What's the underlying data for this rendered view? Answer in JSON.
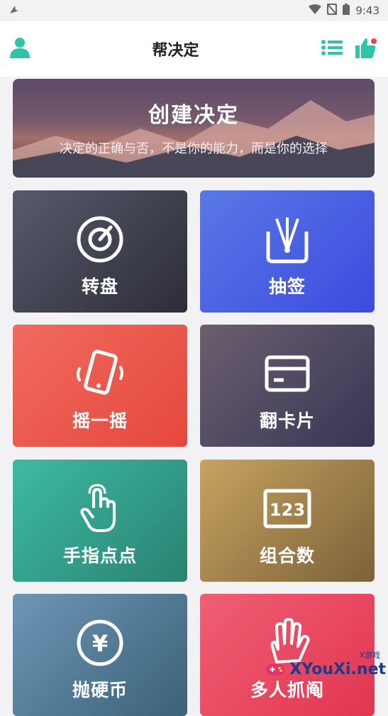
{
  "status_bar": {
    "time": "9:43",
    "icons": [
      "notification-bird-icon",
      "wifi-icon",
      "no-sim-icon",
      "battery-icon"
    ]
  },
  "appbar": {
    "title": "帮决定",
    "left_icon": "user-icon",
    "right_icons": [
      "list-icon",
      "thumbs-up-icon"
    ],
    "accent": "#2ec4a6",
    "badge_color": "#e5484d"
  },
  "banner": {
    "title": "创建决定",
    "subtitle": "决定的正确与否，不是你的能力，而是你的选择"
  },
  "cards": [
    {
      "label": "转盘",
      "icon": "spinner-dial-icon"
    },
    {
      "label": "抽签",
      "icon": "draw-lots-icon"
    },
    {
      "label": "摇一摇",
      "icon": "shake-phone-icon"
    },
    {
      "label": "翻卡片",
      "icon": "flip-card-icon"
    },
    {
      "label": "手指点点",
      "icon": "finger-tap-icon"
    },
    {
      "label": "组合数",
      "icon": "number-combo-icon",
      "icon_text": "123"
    },
    {
      "label": "抛硬币",
      "icon": "coin-toss-icon",
      "icon_text": "¥"
    },
    {
      "label": "多人抓阄",
      "icon": "multi-hand-icon"
    }
  ],
  "watermark": {
    "text": "XYouXi.net",
    "small": "X游戏"
  }
}
